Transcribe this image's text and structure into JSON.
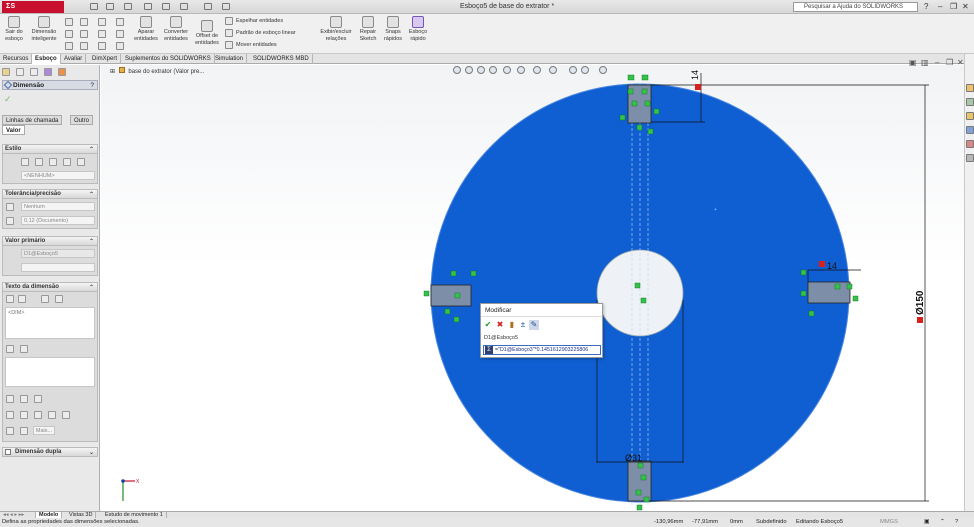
{
  "app": {
    "title": "Esboço5 de base do extrator *"
  },
  "help": {
    "placeholder": "Pesquisar a Ajuda do SOLIDWORKS"
  },
  "ribbon": {
    "exit_sketch": "Sair do\nesboço",
    "smart_dim": "Dimensão\ninteligente",
    "trim": "Aparar\nentidades",
    "convert": "Converter\nentidades",
    "offset": "Offset de\nentidades",
    "mirror": "Espelhar entidades",
    "linear_pattern": "Padrão de esboço linear",
    "move": "Mover entidades",
    "display_relations": "Exibir/excluir\nrelações",
    "repair": "Repair\nSketch",
    "snaps": "Snaps\nrápidos",
    "rapid_sketch": "Esboço\nrápido"
  },
  "tabs": [
    "Recursos",
    "Esboço",
    "Avaliar",
    "DimXpert",
    "Suplementos do SOLIDWORKS",
    "Simulation",
    "SOLIDWORKS MBD"
  ],
  "active_tab": "Esboço",
  "tree": {
    "label": "base do extrator (Valor pre..."
  },
  "panel": {
    "title": "Dimensão",
    "subtabs": [
      "Linhas de chamada",
      "Outro"
    ],
    "value_tab": "Valor",
    "style_head": "Estilo",
    "style_value": "<NENHUM>",
    "tol_head": "Tolerância/precisão",
    "tol_value": "Nenhum",
    "precision_value": "0,12 (Documento)",
    "primary_head": "Valor primário",
    "primary_value": "D1@Esboço5",
    "dimtext_head": "Texto da dimensão",
    "dim_token": "<DIM>",
    "more_btn": "Mais...",
    "dual_head": "Dimensão dupla"
  },
  "drawing": {
    "dim_top": "14",
    "dim_right": "14",
    "dim_diameter": "Ø150",
    "dim_bottom": "Ø31"
  },
  "modify": {
    "title": "Modificar",
    "dim_name": "D1@Esboço5",
    "expression": "=\"D1@Esboço3\"*0.1451612903225806"
  },
  "bottom_tabs": [
    "Modelo",
    "Vistas 3D",
    "Estudo de movimento 1"
  ],
  "status": {
    "message": "Defina as propriedades das dimensões selecionadas.",
    "x": "-130,96mm",
    "y": "-77,91mm",
    "z": "0mm",
    "state": "Subdefinido",
    "editing": "Editando Esboço5",
    "units": "MMGS"
  }
}
